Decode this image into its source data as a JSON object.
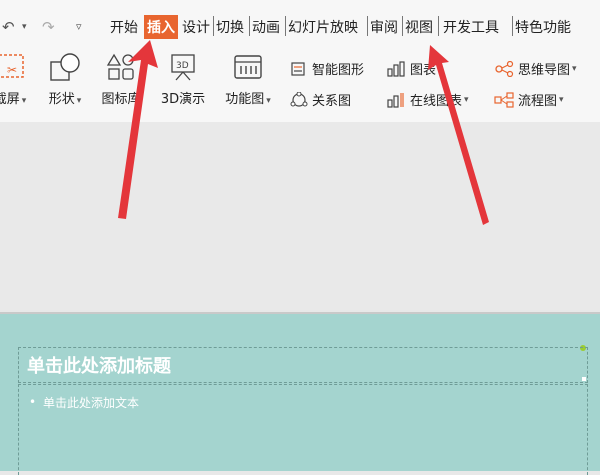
{
  "tabs": [
    {
      "label": "开始"
    },
    {
      "label": "插入"
    },
    {
      "label": "设计"
    },
    {
      "label": "切换"
    },
    {
      "label": "动画"
    },
    {
      "label": "幻灯片放映"
    },
    {
      "label": "审阅"
    },
    {
      "label": "视图"
    },
    {
      "label": "开发工具"
    },
    {
      "label": "特色功能"
    }
  ],
  "tools_big": [
    {
      "label": "截屏"
    },
    {
      "label": "形状"
    },
    {
      "label": "图标库"
    },
    {
      "label": "3D演示"
    },
    {
      "label": "功能图"
    }
  ],
  "tools_small": {
    "smart_shape": "智能图形",
    "chart": "图表",
    "relationship": "关系图",
    "online_chart": "在线图表",
    "mind_map": "思维导图",
    "flowchart": "流程图"
  },
  "slide": {
    "title_placeholder": "单击此处添加标题",
    "text_placeholder": "单击此处添加文本"
  },
  "colors": {
    "active_tab": "#e8652f",
    "slide_bg": "#a4d4cf",
    "arrow": "#e4363b"
  }
}
